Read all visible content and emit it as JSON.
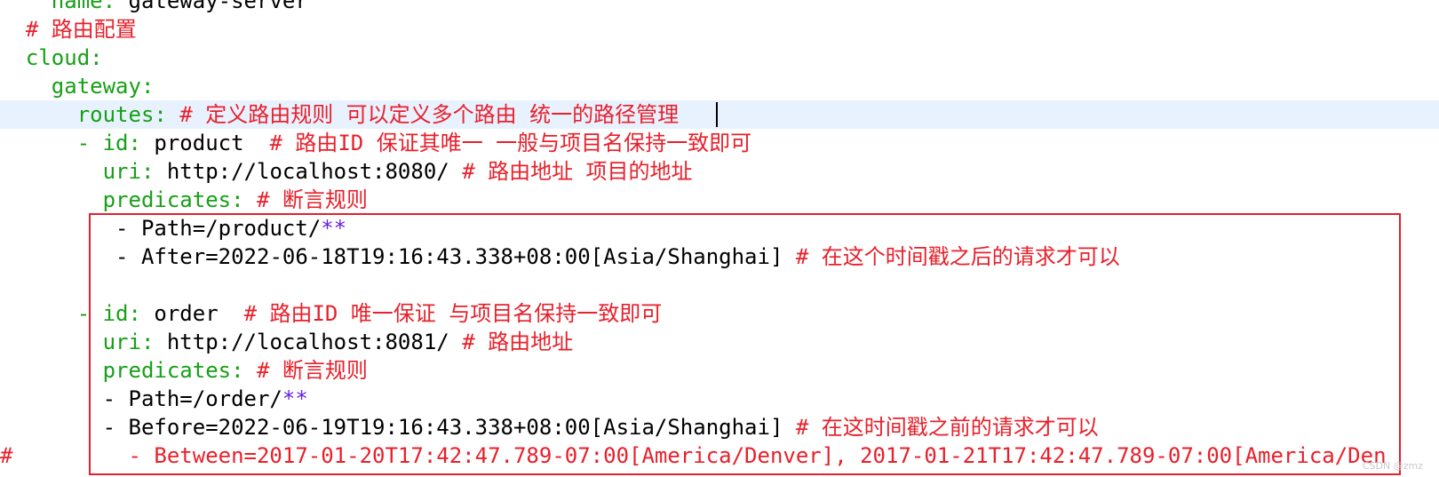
{
  "editor": {
    "lines": [
      {
        "indent": "    ",
        "key": "name: ",
        "value": "gateway-server",
        "comment": ""
      },
      {
        "indent": "  ",
        "key": "",
        "value": "",
        "comment": "# 路由配置"
      },
      {
        "indent": "  ",
        "key": "cloud:",
        "value": "",
        "comment": ""
      },
      {
        "indent": "    ",
        "key": "gateway:",
        "value": "",
        "comment": ""
      },
      {
        "indent": "      ",
        "key": "routes: ",
        "value": "",
        "comment": "# 定义路由规则 可以定义多个路由 统一的路径管理"
      },
      {
        "indent": "      ",
        "key": "- id: ",
        "value": "product  ",
        "comment": "# 路由ID 保证其唯一 一般与项目名保持一致即可"
      },
      {
        "indent": "        ",
        "key": "uri: ",
        "value": "http://localhost:8080/ ",
        "comment": "# 路由地址 项目的地址"
      },
      {
        "indent": "        ",
        "key": "predicates: ",
        "value": "",
        "comment": "# 断言规则"
      },
      {
        "indent": "         ",
        "key": "",
        "value": "- Path=/product/",
        "op": "**",
        "comment": ""
      },
      {
        "indent": "         ",
        "key": "",
        "value": "- After=2022-06-18T19:16:43.338+08:00[Asia/Shanghai] ",
        "comment": "# 在这个时间戳之后的请求才可以"
      },
      {
        "indent": "",
        "key": "",
        "value": "",
        "comment": ""
      },
      {
        "indent": "      ",
        "key": "- id: ",
        "value": "order  ",
        "comment": "# 路由ID 唯一保证 与项目名保持一致即可"
      },
      {
        "indent": "        ",
        "key": "uri: ",
        "value": "http://localhost:8081/ ",
        "comment": "# 路由地址"
      },
      {
        "indent": "        ",
        "key": "predicates: ",
        "value": "",
        "comment": "# 断言规则"
      },
      {
        "indent": "        ",
        "key": "",
        "value": "- Path=/order/",
        "op": "**",
        "comment": ""
      },
      {
        "indent": "        ",
        "key": "",
        "value": "- Before=2022-06-19T19:16:43.338+08:00[Asia/Shanghai] ",
        "comment": "# 在这时间戳之前的请求才可以"
      },
      {
        "indent": "",
        "key": "",
        "value": "",
        "comment": "#         - Between=2017-01-20T17:42:47.789-07:00[America/Denver], 2017-01-21T17:42:47.789-07:00[America/Den"
      }
    ],
    "current_line": 4
  },
  "colors": {
    "key": "#17a017",
    "value": "#000000",
    "comment": "#e8202b",
    "operator": "#6a1fe6",
    "current_line_bg": "#e8f2fe",
    "highlight_box": "#e22030"
  },
  "watermark": "CSDN @zmz"
}
